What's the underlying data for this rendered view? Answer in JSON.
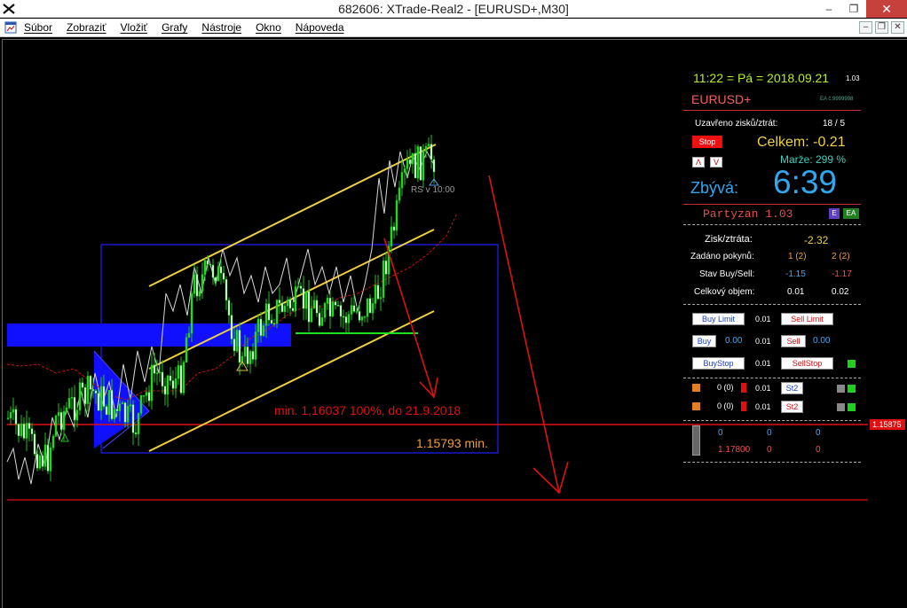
{
  "window": {
    "title": "682606: XTrade-Real2 - [EURUSD+,M30]",
    "buttons": {
      "minimize": "–",
      "restore": "❐",
      "close": "✕"
    }
  },
  "menu": {
    "items": [
      "Súbor",
      "Zobraziť",
      "Vložiť",
      "Grafy",
      "Nástroje",
      "Okno",
      "Nápoveda"
    ],
    "mdi": {
      "minimize": "–",
      "restore": "❐",
      "close": "✕"
    }
  },
  "chart": {
    "annotation_min": "min. 1,16037  100%, do 21.9.2018",
    "annotation_level": "1.15793 min.",
    "annotation_rs": "RS v 10:00",
    "price_tag": "1.15875",
    "colors": {
      "channel": "#f0d040",
      "red_line": "#e01010",
      "box": "#2020ff",
      "green": "#20e020"
    }
  },
  "panel": {
    "clock": "11:22 = Pá = 2018.09.21",
    "version_small": "1.03",
    "symbol": "EURUSD+",
    "ea_small": "EA č.9999998",
    "closed_label": "Uzavřeno zisků/ztrát:",
    "closed_value": "18 / 5",
    "stop_button": "Stop",
    "total_label": "Celkem: -0.21",
    "margin_label": "Marže:  299 %",
    "arrow_up": "Λ",
    "arrow_down": "V",
    "remaining_label": "Zbývá:",
    "remaining_value": "6:39",
    "ea_name": "Partyzan 1.03",
    "badge_e": "E",
    "badge_ea": "EA",
    "pl_label": "Zisk/ztráta:",
    "pl_value": "-2.32",
    "orders_label": "Zadáno pokynů:",
    "orders_buy": "1 (2)",
    "orders_sell": "2 (2)",
    "state_label": "Stav Buy/Sell:",
    "state_buy": "-1.15",
    "state_sell": "-1.17",
    "volume_label": "Celkový objem:",
    "volume_buy": "0.01",
    "volume_sell": "0.02",
    "buy_limit": "Buy Limit",
    "sell_limit": "Sell Limit",
    "buy": "Buy",
    "sell": "Sell",
    "buy_stop": "BuyStop",
    "sell_stop": "SellStop",
    "lot": "0.01",
    "buy_price": "0.00",
    "sell_price": "0.00",
    "row1_count": "0 (0)",
    "row2_count": "0 (0)",
    "st2": "St2",
    "bottom_a": "0",
    "bottom_b": "0",
    "bottom_c": "0",
    "bottom_price": "1.17800",
    "bottom_d": "0",
    "bottom_e": "0"
  }
}
